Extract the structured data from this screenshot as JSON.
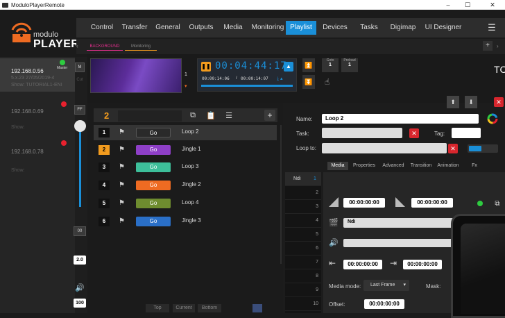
{
  "window": {
    "title": "ModuloPlayerRemote",
    "minimize": "–",
    "maximize": "☐",
    "close": "✕"
  },
  "logo": {
    "line1": "modulo",
    "line2": "PLAYER"
  },
  "menu": {
    "items": [
      "Control",
      "Transfer",
      "General",
      "Outputs",
      "Media",
      "Monitoring",
      "Playlist",
      "Devices",
      "Tasks",
      "Digimap",
      "UI Designer"
    ],
    "active": "Playlist",
    "hamburger": "☰"
  },
  "subtabs": {
    "background": "BACKGROUND",
    "monitoring": "Monitoring"
  },
  "devices": [
    {
      "ip": "192.168.0.56",
      "badge": "Master",
      "version": "5.x.23 27/05/2019-4",
      "show": "Show: TUTORIAL1-ENI",
      "status_color": "#2ecc40"
    },
    {
      "ip": "192.168.0.69",
      "show": "Show:",
      "status_color": "#e8212e"
    },
    {
      "ip": "192.168.0.78",
      "show": "Show:",
      "status_color": "#e8212e"
    }
  ],
  "side_buttons": {
    "m": "M",
    "cut": "Cut",
    "ff": "FF",
    "zero": "00",
    "speed": "2.0",
    "volume": "100"
  },
  "preview": {
    "layer": "1"
  },
  "timecode": {
    "main": "00:04:44:17",
    "elapsed": "00:00:14:06",
    "total": "00:00:14:07"
  },
  "goto": {
    "label": "Goto",
    "value": "1"
  },
  "preload": {
    "label": "Preload",
    "value": "1"
  },
  "tc_partial": "TC",
  "playlist": {
    "number": "2",
    "rows": [
      {
        "num": "1",
        "go": "Go",
        "name": "Loop 2",
        "color": "#2a2a2a",
        "selected": false,
        "current": true
      },
      {
        "num": "2",
        "go": "Go",
        "name": "Jingle 1",
        "color": "#8e3fc7",
        "selected": true,
        "current": false
      },
      {
        "num": "3",
        "go": "Go",
        "name": "Loop 3",
        "color": "#3dbf9a",
        "selected": false,
        "current": false
      },
      {
        "num": "4",
        "go": "Go",
        "name": "Jingle 2",
        "color": "#ee6b22",
        "selected": false,
        "current": false
      },
      {
        "num": "5",
        "go": "Go",
        "name": "Loop 4",
        "color": "#6e8c2f",
        "selected": false,
        "current": false
      },
      {
        "num": "6",
        "go": "Go",
        "name": "Jingle 3",
        "color": "#2a6fc7",
        "selected": false,
        "current": false
      }
    ],
    "bottom": {
      "top": "Top",
      "current": "Current",
      "bottom": "Bottom"
    }
  },
  "cue": {
    "name_label": "Name:",
    "name_value": "Loop 2",
    "task_label": "Task:",
    "tag_label": "Tag:",
    "loop_label": "Loop to:",
    "tabs": [
      "Media",
      "Properties",
      "Advanced",
      "Transition",
      "Animation",
      "Fx"
    ],
    "active_tab": "Media",
    "channels": {
      "ndi": "Ndi",
      "numbers": [
        "1",
        "2",
        "3",
        "4",
        "5",
        "6",
        "7",
        "8",
        "9",
        "10"
      ]
    },
    "in_time": "00:00:00:00",
    "out_time": "00:00:00:00",
    "media_name": "Ndi",
    "trim_in": "00:00:00:00",
    "trim_out": "00:00:00:00",
    "media_mode_label": "Media mode:",
    "media_mode_value": "Last Frame",
    "mask_label": "Mask:",
    "offset_label": "Offset:",
    "offset_value": "00:00:00:00"
  }
}
